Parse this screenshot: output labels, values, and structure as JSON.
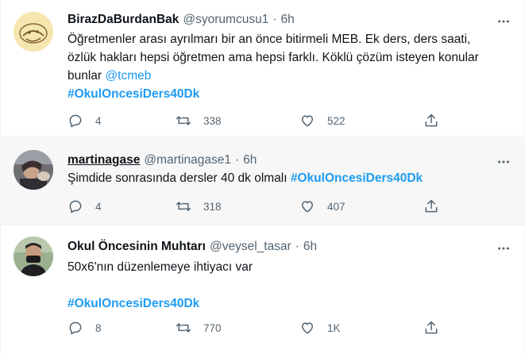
{
  "tweets": [
    {
      "name": "BirazDaBurdanBak",
      "handle": "@syorumcusu1",
      "separator": "·",
      "time": "6h",
      "text_lines": [
        "Öğretmenler arası ayrılmarı bir an önce bitirmeli MEB. Ek ders, ders saati,",
        "özlük hakları hepsi öğretmen ama hepsi farklı. Köklü çözüm isteyen konular",
        "bunlar"
      ],
      "mention": "@tcmeb",
      "hashtag": "#OkulOncesiDers40Dk",
      "replies": "4",
      "retweets": "338",
      "likes": "522"
    },
    {
      "name": "martinagase",
      "handle": "@martinagase1",
      "separator": "·",
      "time": "6h",
      "text": "Şimdide sonrasında dersler 40 dk olmalı",
      "hashtag": "#OkulOncesiDers40Dk",
      "replies": "4",
      "retweets": "318",
      "likes": "407"
    },
    {
      "name": "Okul Öncesinin Muhtarı",
      "handle": "@veysel_tasar",
      "separator": "·",
      "time": "6h",
      "text": "50x6'nın  düzenlemeye ihtiyacı var",
      "hashtag": "#OkulOncesiDers40Dk",
      "replies": "8",
      "retweets": "770",
      "likes": "1K"
    }
  ],
  "icons": {
    "more": "more-horizontal-icon",
    "reply": "reply-icon",
    "retweet": "retweet-icon",
    "like": "like-heart-icon",
    "share": "share-icon"
  },
  "colors": {
    "accent": "#1d9bf0",
    "secondary_text": "#536471",
    "hover_background": "#f7f7f7"
  }
}
